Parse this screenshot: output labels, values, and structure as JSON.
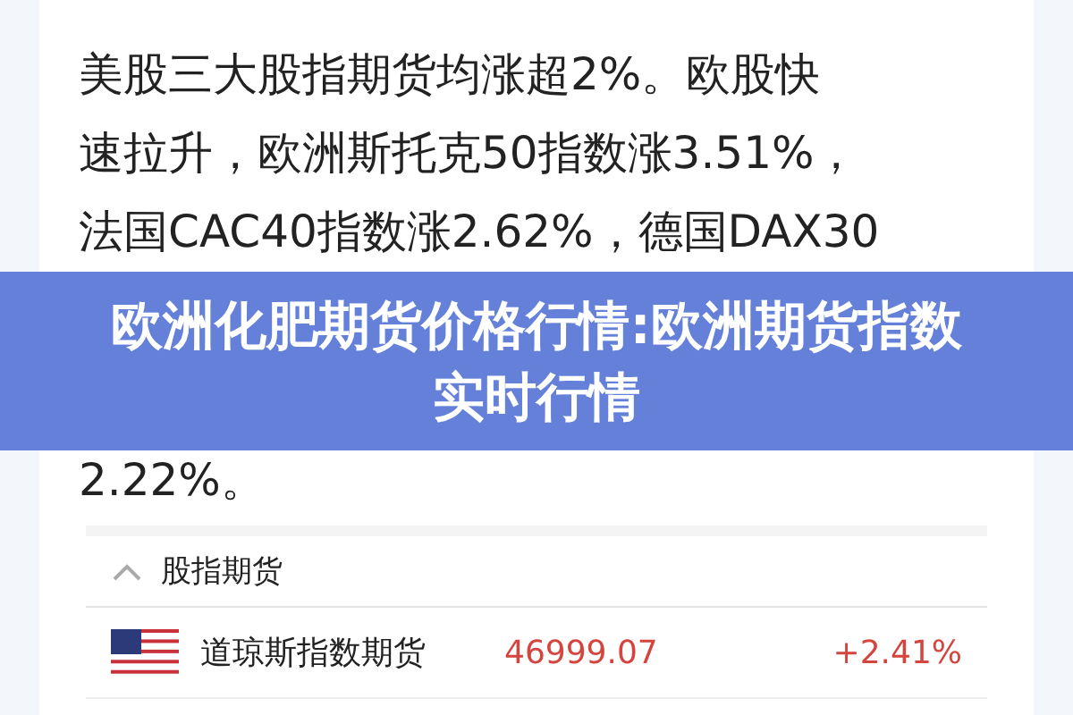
{
  "article": {
    "lines": [
      "美股三大股指期货均涨超2%。欧股快",
      "速拉升，欧洲斯托克50指数涨3.51%，",
      "法国CAC40指数涨2.62%，德国DAX30"
    ],
    "after_banner": "2.22%。"
  },
  "banner": {
    "title": "欧洲化肥期货价格行情:欧洲期货指数实时行情"
  },
  "section": {
    "title": "股指期货",
    "expanded": true,
    "rows": [
      {
        "name": "道琼斯指数期货",
        "price": "46999.07",
        "change": "+2.41%",
        "up": true
      }
    ]
  }
}
